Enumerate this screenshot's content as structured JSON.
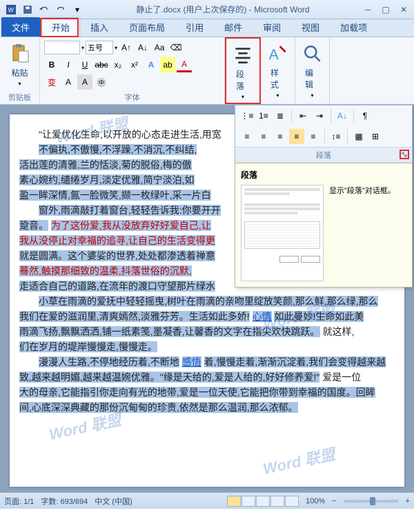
{
  "title": "静止了.docx (用户上次保存的) - Microsoft Word",
  "tabs": {
    "file": "文件",
    "home": "开始",
    "insert": "插入",
    "layout": "页面布局",
    "references": "引用",
    "mailings": "邮件",
    "review": "审阅",
    "view": "视图",
    "addins": "加载项"
  },
  "ribbon": {
    "clipboard": {
      "label": "剪贴板",
      "paste": "粘贴"
    },
    "font": {
      "label": "字体",
      "size": "五号"
    },
    "paragraph": {
      "label": "段落"
    },
    "styles": {
      "label": "样式"
    },
    "editing": {
      "label": "编辑"
    }
  },
  "flyout": {
    "group_label": "段落",
    "tooltip_title": "段落",
    "tooltip_text": "显示\"段落\"对话框。"
  },
  "document": {
    "p1": "\"让爱优化生命,以开放的心态走进生活,用宽",
    "p2_a": "不偏执,不傲慢,不浮躁,不消沉,不纠结,",
    "p2_b": "活出莲的清雅,兰的恬淡,菊的脱俗,梅的傲",
    "p2_c": "素心婉约,缱绻岁月,淡定优雅,简宁淡泊,如",
    "p2_d": "盈一眸深情,氤一脸微笑,撷一枚绿叶,采一片白",
    "p3_a": "窗外,雨滴敲打着窗台,轻轻告诉我:你要开开",
    "p3_b": "跫音。",
    "p3_c": "为了这份爱,我从没放弃好好爱自己,让",
    "p3_d": "我从没停止对幸福的追寻,让自己的生活变得更",
    "p3_e": "就是圆满。这个婆娑的世界,处处都渗透着禅意",
    "p3_f": "蓦然,触摸那细致的温柔,抖落世俗的沉默,",
    "p3_g": "走适合自己的道路,在流年的渡口守望那片绿水",
    "p4_a": "小草在雨滴的爱抚中轻轻摇曳,树叶在雨滴的亲吻里绽放笑颜,那么鲜,那么绿,那么",
    "p4_b": "我们在爱的滋润里,清爽嫣然,淡雅芬芳。生活如此多娇!",
    "p4_link": "心情",
    "p4_c": "如此曼妙!生命如此美",
    "p4_d": "雨滴飞扬,飘飘洒洒,铺一纸素笺,墨凝香,让馨香的文字在指尖欢快跳跃。",
    "p4_e": "就这样,",
    "p4_f": "们在岁月的堤岸慢慢走,慢慢走。",
    "p5_a": "漫漫人生路,不停地经历着,不断地",
    "p5_link": "感悟",
    "p5_b": "着,慢慢走着,渐渐沉淀着,我们会变得越来越",
    "p5_c": "致,越来越明媚,越来越温婉优雅。\"缘是天给的,爱是人给的,好好修养爱!\"",
    "p5_d": "爱是一位",
    "p5_e": "大的母亲,它能指引你走向有光的地带,爱是一位天使,它能把你带到幸福的国度。回眸",
    "p5_f": "间,心底深深典藏的那份沉甸甸的珍贵,依然是那么温润,那么浓郁。"
  },
  "statusbar": {
    "page": "页面: 1/1",
    "words": "字数: 693/694",
    "lang": "中文 (中国)",
    "zoom": "100%"
  },
  "watermark": "Word 联盟"
}
